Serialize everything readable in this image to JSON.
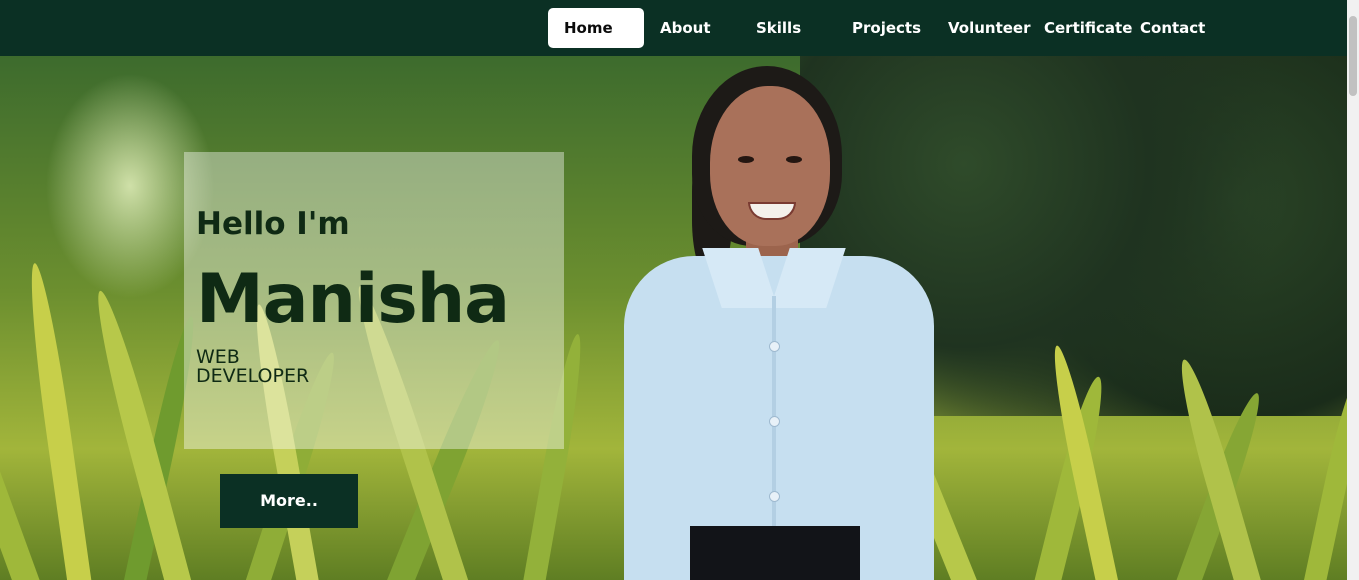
{
  "nav": {
    "items": [
      {
        "label": "Home",
        "active": true
      },
      {
        "label": "About",
        "active": false
      },
      {
        "label": "Skills",
        "active": false
      },
      {
        "label": "Projects",
        "active": false
      },
      {
        "label": "Volunteer",
        "active": false
      },
      {
        "label": "Certificate",
        "active": false
      },
      {
        "label": "Contact",
        "active": false
      }
    ]
  },
  "hero": {
    "greeting": "Hello I'm",
    "name": "Manisha",
    "role": "WEB DEVELOPER",
    "more_button": "More.."
  },
  "colors": {
    "nav_background": "#0b3024",
    "active_nav_background": "#ffffff",
    "button_background": "#0b3024",
    "heading_text": "#0f2a14"
  }
}
